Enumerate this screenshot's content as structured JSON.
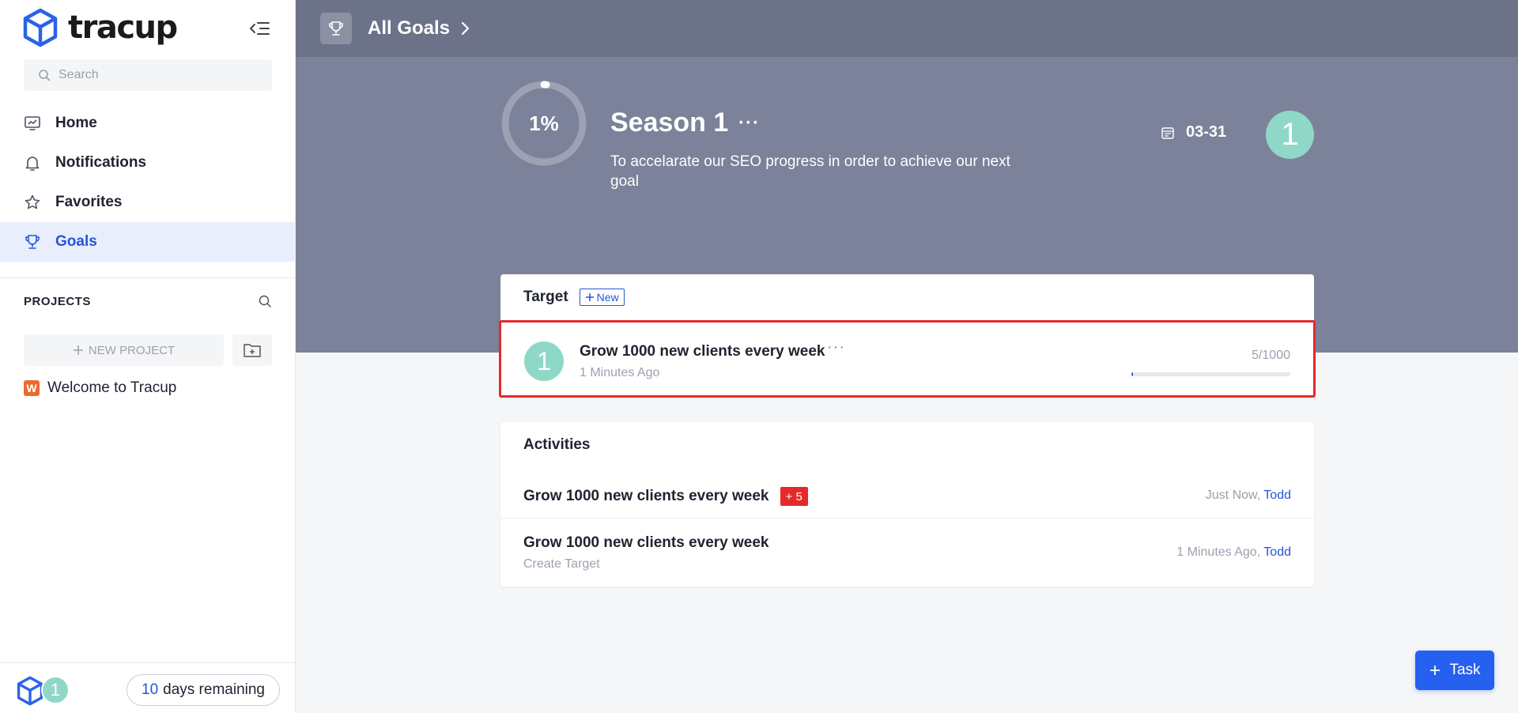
{
  "sidebar": {
    "brand": "tracup",
    "search_placeholder": "Search",
    "nav": [
      {
        "label": "Home",
        "icon": "home-chart-icon"
      },
      {
        "label": "Notifications",
        "icon": "bell-icon"
      },
      {
        "label": "Favorites",
        "icon": "star-icon"
      },
      {
        "label": "Goals",
        "icon": "trophy-icon",
        "active": true
      }
    ],
    "projects_title": "PROJECTS",
    "new_project_label": "NEW PROJECT",
    "projects": [
      {
        "badge": "W",
        "name": "Welcome to Tracup",
        "badge_color": "#ec6a2c"
      }
    ],
    "footer": {
      "avatar_initial": "1",
      "trial_days": "10",
      "trial_suffix": "days remaining"
    }
  },
  "topbar": {
    "title": "All Goals"
  },
  "goal": {
    "progress_label": "1%",
    "progress": 0.01,
    "title": "Season 1",
    "more": "···",
    "description": "To accelarate our SEO progress in order to achieve our next goal",
    "due_date": "03-31",
    "owner_initial": "1"
  },
  "target_card": {
    "title": "Target",
    "new_label": "New",
    "items": [
      {
        "avatar_initial": "1",
        "name": "Grow 1000 new clients every week",
        "more": "···",
        "time": "1 Minutes Ago",
        "count": "5/1000",
        "progress": 0.005
      }
    ]
  },
  "activities": {
    "title": "Activities",
    "items": [
      {
        "name": "Grow 1000 new clients every week",
        "badge": "+ 5",
        "time": "Just Now,",
        "user": "Todd"
      },
      {
        "name": "Grow 1000 new clients every week",
        "sub": "Create Target",
        "time": "1 Minutes Ago,",
        "user": "Todd"
      }
    ]
  },
  "task_button": {
    "label": "Task"
  },
  "colors": {
    "accent": "#2456d8",
    "header_bg": "#6c7389",
    "hero_bg": "#7b8299",
    "avatar": "#8fd8c7",
    "highlight": "#e5292a"
  }
}
